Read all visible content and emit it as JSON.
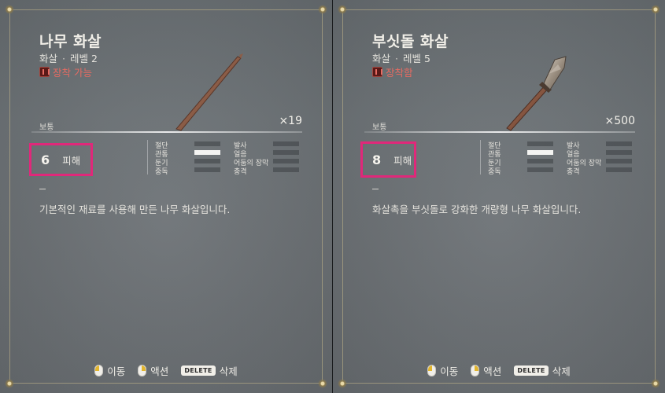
{
  "panels": [
    {
      "title": "나무 화살",
      "category": "화살",
      "level": "레벨 2",
      "equip_status": "장착 가능",
      "rarity": "보통",
      "count": "×19",
      "damage_value": "6",
      "damage_label": "피해",
      "stats_left": [
        "절단",
        "관통",
        "둔기",
        "중독"
      ],
      "stats_right": [
        "발사",
        "얼음",
        "어둠의 장막",
        "충격"
      ],
      "stat_levels_left": [
        0,
        1,
        0,
        0
      ],
      "stat_levels_right": [
        0,
        0,
        0,
        0
      ],
      "description": "기본적인 재료를 사용해 만든 나무 화살입니다."
    },
    {
      "title": "부싯돌 화살",
      "category": "화살",
      "level": "레벨 5",
      "equip_status": "장착함",
      "rarity": "보통",
      "count": "×500",
      "damage_value": "8",
      "damage_label": "피해",
      "stats_left": [
        "절단",
        "관통",
        "둔기",
        "중독"
      ],
      "stats_right": [
        "발사",
        "얼음",
        "어둠의 장막",
        "충격"
      ],
      "stat_levels_left": [
        0,
        1,
        0,
        0
      ],
      "stat_levels_right": [
        0,
        0,
        0,
        0
      ],
      "description": "화살촉을 부싯돌로 강화한 개량형 나무 화살입니다."
    }
  ],
  "footer": {
    "move_label": "이동",
    "action_label": "액션",
    "delete_key": "DELETE",
    "delete_label": "삭제"
  },
  "colors": {
    "highlight_box": "#e0287a",
    "equip_text": "#e66b62"
  }
}
